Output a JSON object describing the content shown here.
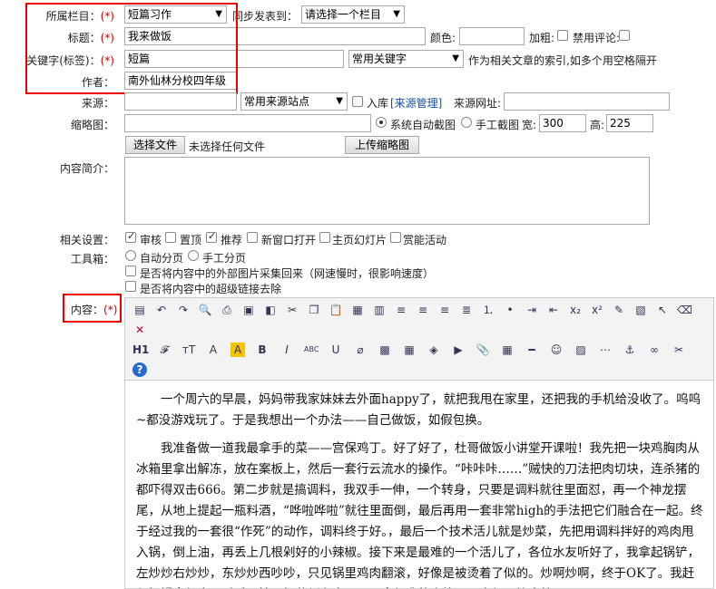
{
  "form": {
    "column_label": "所属栏目：",
    "req": "(*)",
    "column_value": "短篇习作",
    "sync_label": "同步发表到：",
    "sync_value": "请选择一个栏目",
    "title_label": "标题：",
    "title_value": "我来做饭",
    "color_label": "颜色:",
    "color_value": "",
    "bold_label": "加粗:",
    "disable_comment_label": "禁用评论:",
    "keyword_label": "关键字(标签)：",
    "keyword_value": "短篇",
    "keyword_select": "常用关键字",
    "keyword_hint": "作为相关文章的索引,如多个用空格隔开",
    "author_label": "作者：",
    "author_value": "南外仙林分校四年级",
    "source_label": "来源：",
    "source_value": "",
    "source_select": "常用来源站点",
    "ruku_label": "入库",
    "source_manage": "[来源管理]",
    "source_url_label": "来源网址:",
    "source_url_value": "",
    "thumb_label": "缩略图：",
    "thumb_value": "",
    "auto_shot_label": "系统自动截图",
    "manual_shot_label": "手工截图",
    "width_label": "宽:",
    "width_value": "300",
    "height_label": "高:",
    "height_value": "225",
    "choose_file": "选择文件",
    "no_file": "未选择任何文件",
    "upload_thumb": "上传缩略图",
    "summary_label": "内容简介：",
    "summary_value": "",
    "related_label": "相关设置：",
    "related": {
      "review": "审核",
      "top": "置顶",
      "recommend": "推荐",
      "new_window": "新窗口打开",
      "slideshow": "主页幻灯片",
      "reward": "赏能活动"
    },
    "toolbox_label": "工具箱：",
    "auto_page": "自动分页",
    "manual_page": "手工分页",
    "collect_images": "是否将内容中的外部图片采集回来（网速慢时，很影响速度）",
    "remove_links": "是否将内容中的超级链接去除",
    "content_label": "内容："
  },
  "toolbar": {
    "row1": [
      "source-icon",
      "undo-icon",
      "redo-icon",
      "preview-icon",
      "print-icon",
      "template-icon",
      "code-icon",
      "cut-icon",
      "copy-icon",
      "paste-icon",
      "paste-text-icon",
      "paste-word-icon",
      "align-left-icon",
      "align-center-icon",
      "align-right-icon",
      "align-justify-icon",
      "ordered-list-icon",
      "unordered-list-icon",
      "indent-icon",
      "outdent-icon",
      "subscript-icon",
      "superscript-icon",
      "clear-format-icon",
      "select-all-icon",
      "cursor-icon",
      "remove-format-icon"
    ],
    "row2": [
      "heading-icon",
      "font-family-icon",
      "font-size-icon",
      "font-color-icon",
      "highlight-icon",
      "bold-icon",
      "italic-icon",
      "strikethrough-icon",
      "underline-icon",
      "eraser-icon",
      "image-icon",
      "multi-image-icon",
      "flash-icon",
      "media-icon",
      "attach-icon",
      "table-icon",
      "hr-icon",
      "emoticon-icon",
      "map-icon",
      "pagebreak-icon",
      "anchor-icon",
      "link-icon",
      "unlink-icon"
    ],
    "help": "help-icon"
  },
  "content": {
    "p1": "一个周六的早晨，妈妈带我家妹妹去外面happy了，就把我甩在家里，还把我的手机给没收了。呜呜~都没游戏玩了。于是我想出一个办法——自己做饭，如假包换。",
    "p2": "我准备做一道我最拿手的菜——宫保鸡丁。好了好了，杜哥做饭小讲堂开课啦！我先把一块鸡胸肉从冰箱里拿出解冻，放在案板上，然后一套行云流水的操作。“咔咔咔……”贼快的刀法把肉切块，连杀猪的都吓得双击666。第二步就是搞调料，我双手一伸，一个转身，只要是调料就往里面怼，再一个神龙摆尾，从地上提起一瓶料酒，“哗啦哗啦”就往里面倒，最后再用一套非常high的手法把它们融合在一起。终于经过我的一套很“作死”的动作，调料终于好。，最后一个技术活儿就是炒菜，先把用调料拌好的鸡肉甩入锅，倒上油，再丢上几根剁好的小辣椒。接下来是最难的一个活儿了，各位水友听好了，我拿起锅铲，左炒炒右炒炒，东炒炒西吵吵，只见锅里鸡肉翻滚，好像是被烫着了似的。炒啊炒啊，终于OK了。我赶紧把锅拿起来，反手一抡，把菜倒在盘子里。拿起我的小筷子，夹起一块肉放入口"
  }
}
